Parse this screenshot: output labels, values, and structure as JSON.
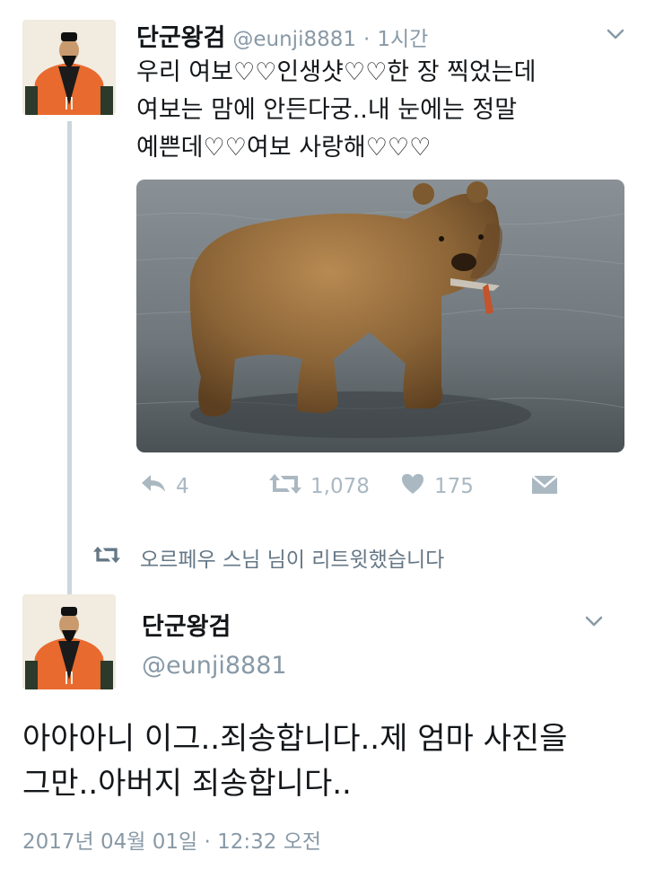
{
  "tweet1": {
    "author_name": "단군왕검",
    "handle": "@eunji8881",
    "time_sep": "·",
    "time": "1시간",
    "text_lines": [
      "우리 여보♡♡인생샷♡♡한 장 찍었는데",
      "여보는 맘에 안든다궁..내 눈에는 정말",
      "예쁜데♡♡여보 사랑해♡♡♡"
    ],
    "actions": {
      "reply_count": "4",
      "retweet_count": "1,078",
      "like_count": "175"
    },
    "icons": [
      "reply-icon",
      "retweet-icon",
      "heart-icon",
      "dm-icon",
      "chevron-down-icon"
    ]
  },
  "retweet_notice": {
    "text": "오르페우 스님 님이 리트윗했습니다"
  },
  "tweet2": {
    "author_name": "단군왕검",
    "handle": "@eunji8881",
    "text_lines": [
      "아아아니 이그..죄송합니다..제 엄마 사진을",
      "그만..아버지 죄송합니다.."
    ],
    "timestamp": "2017년 04월 01일 · 12:32 오전"
  },
  "colors": {
    "meta_gray": "#8899a6",
    "action_gray": "#aab8c2",
    "thread_line": "#ccd6dd",
    "robe_orange": "#e86a2e"
  }
}
